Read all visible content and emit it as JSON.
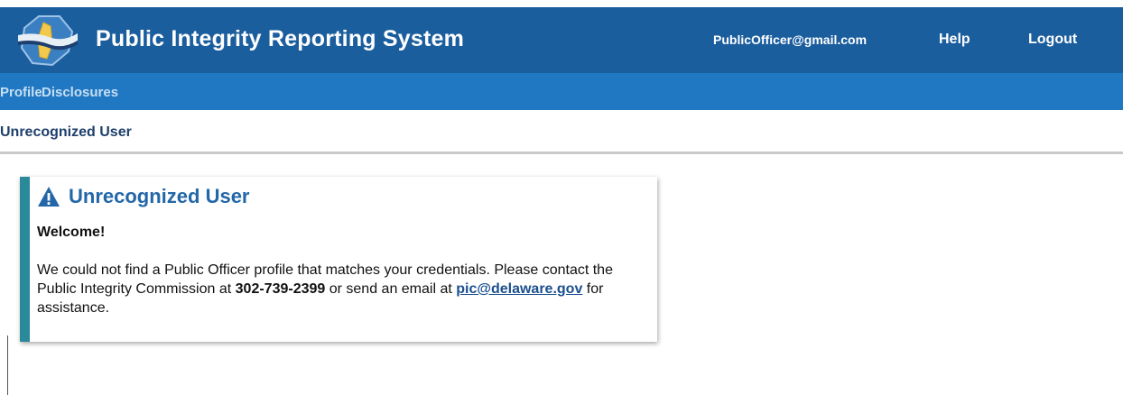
{
  "header": {
    "app_title": "Public Integrity Reporting System",
    "user_email": "PublicOfficer@gmail.com",
    "help_label": "Help",
    "logout_label": "Logout",
    "logo_icon": "delaware-state-logo-icon"
  },
  "nav": {
    "items": [
      {
        "label": "Profile"
      },
      {
        "label": "Disclosures"
      }
    ]
  },
  "page": {
    "title": "Unrecognized User"
  },
  "alert": {
    "icon": "warning-icon",
    "title": "Unrecognized User",
    "welcome": "Welcome!",
    "message_part1": "We could not find a Public Officer profile that matches your credentials. Please contact the Public Integrity Commission at ",
    "phone": "302-739-2399",
    "message_part2": " or send an email at ",
    "email": "pic@delaware.gov",
    "message_part3": " for assistance."
  },
  "colors": {
    "header_bg": "#1b5e9e",
    "nav_bg": "#2078c3",
    "alert_accent": "#2b8a9a",
    "alert_title": "#2367a8",
    "page_title": "#1e3f6b"
  }
}
